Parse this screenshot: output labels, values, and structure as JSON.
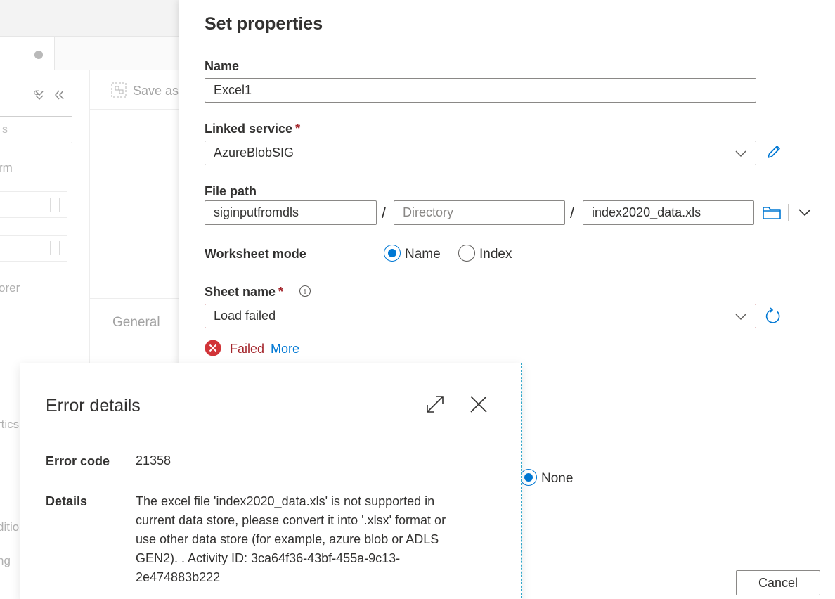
{
  "background": {
    "toolbar": {
      "save_as_label": "Save as"
    },
    "left_pane": {
      "search_placeholder_fragment": "s",
      "fragment_rm": "rm",
      "fragment_orer": "orer",
      "fragment_rtics": "rtics",
      "fragment_ditio": "ditio",
      "fragment_ng": "ng"
    },
    "bottom_tabs": {
      "general_label": "General"
    }
  },
  "panel": {
    "title": "Set properties",
    "name": {
      "label": "Name",
      "value": "Excel1"
    },
    "linked_service": {
      "label": "Linked service",
      "required_mark": "*",
      "value": "AzureBlobSIG"
    },
    "file_path": {
      "label": "File path",
      "container": "siginputfromdls",
      "separator": "/",
      "directory_placeholder": "Directory",
      "file": "index2020_data.xls"
    },
    "worksheet_mode": {
      "label": "Worksheet mode",
      "options": [
        {
          "label": "Name",
          "selected": true
        },
        {
          "label": "Index",
          "selected": false
        }
      ]
    },
    "sheet_name": {
      "label": "Sheet name",
      "required_mark": "*",
      "info_glyph": "i",
      "value": "Load failed"
    },
    "status": {
      "text": "Failed",
      "more_link": "More"
    },
    "partial_option": {
      "label": "None",
      "selected": true
    },
    "footer": {
      "cancel_label": "Cancel"
    }
  },
  "error_details": {
    "title": "Error details",
    "error_code_label": "Error code",
    "error_code": "21358",
    "details_label": "Details",
    "details_lines": [
      "The excel file 'index2020_data.xls' is not supported in",
      "current data store, please convert it into '.xlsx' format or",
      "use other data store (for example, azure blob or ADLS",
      "GEN2). . Activity ID: 3ca64f36-43bf-455a-9c13-",
      "2e474883b222"
    ]
  },
  "colors": {
    "accent": "#0078d4",
    "error": "#a4262c",
    "error_icon": "#d13438",
    "callout_border": "#2fa6c9",
    "text": "#323130"
  }
}
